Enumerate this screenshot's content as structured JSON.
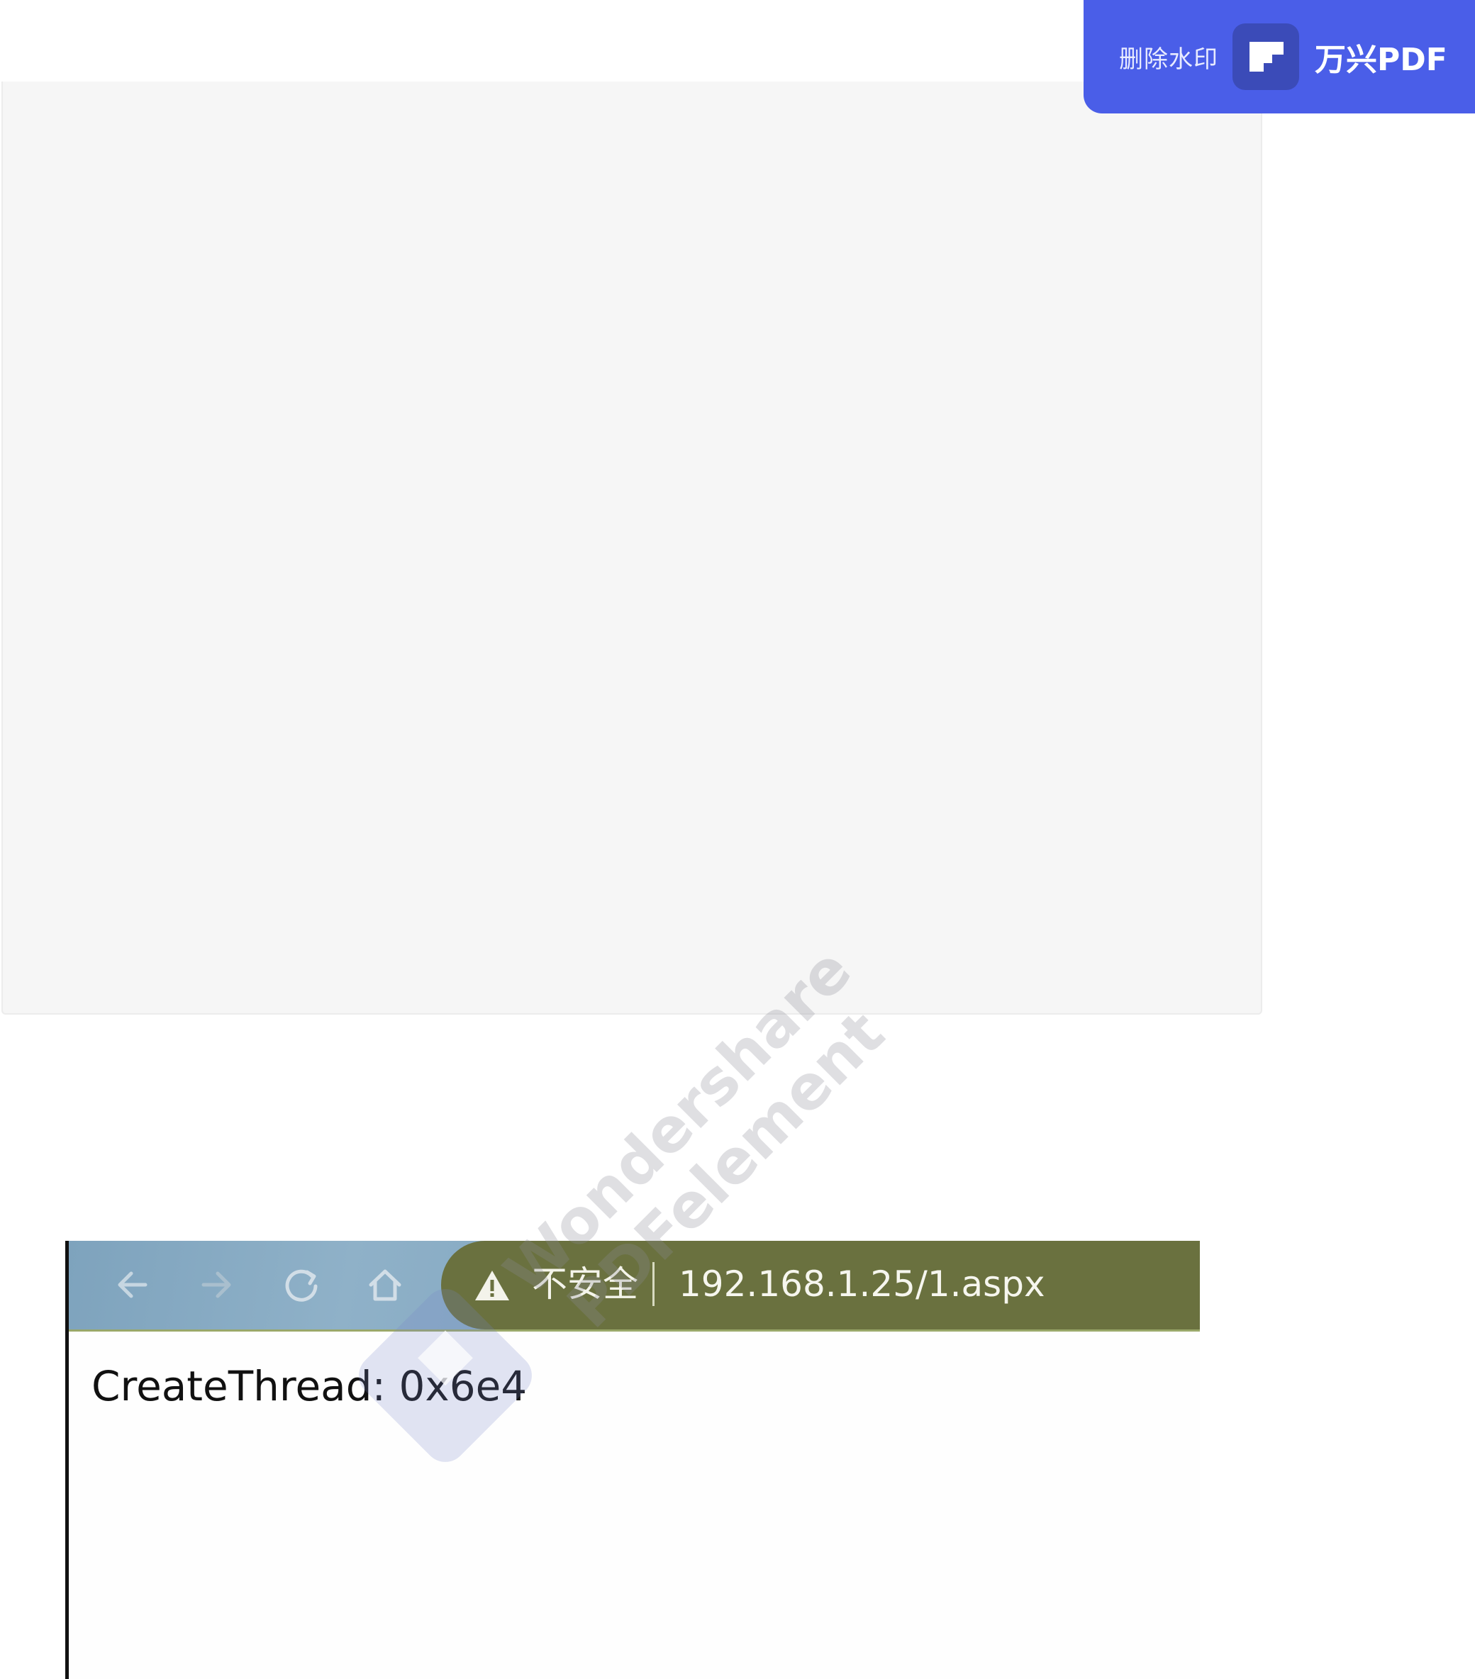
{
  "watermark_banner": {
    "remove_label": "删除水印",
    "brand": "万兴PDF",
    "accent_color": "#4a5ee8"
  },
  "browser": {
    "nav": {
      "back_icon": "arrow-left-icon",
      "forward_icon": "arrow-right-icon",
      "reload_icon": "reload-icon",
      "home_icon": "home-icon"
    },
    "address_bar": {
      "security_icon": "warning-triangle-icon",
      "security_label": "不安全",
      "url": "192.168.1.25/1.aspx"
    },
    "page_content": "CreateThread: 0x6e4"
  },
  "watermark_diagonal": {
    "line1": "Wondershare",
    "line2": "PDFelement"
  }
}
